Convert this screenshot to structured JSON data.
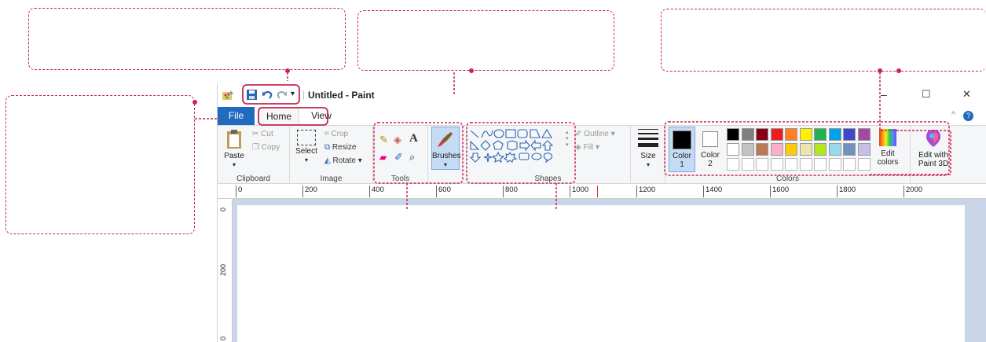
{
  "window": {
    "title": "Untitled - Paint",
    "controls": {
      "minimize": "–",
      "maximize": "☐",
      "close": "✕"
    }
  },
  "tabs": {
    "file": "File",
    "home": "Home",
    "view": "View"
  },
  "clipboard": {
    "paste": "Paste",
    "cut": "Cut",
    "copy": "Copy",
    "label": "Clipboard"
  },
  "image": {
    "select": "Select",
    "crop": "Crop",
    "resize": "Resize",
    "rotate": "Rotate",
    "label": "Image"
  },
  "tools": {
    "label": "Tools"
  },
  "brushes": {
    "label": "Brushes"
  },
  "shapes": {
    "outline": "Outline",
    "fill": "Fill",
    "label": "Shapes"
  },
  "size": {
    "label": "Size"
  },
  "colors": {
    "color1": "Color",
    "color1_num": "1",
    "color2": "Color",
    "color2_num": "2",
    "edit": "Edit",
    "edit2": "colors",
    "label": "Colors",
    "palette_row1": [
      "#000000",
      "#7f7f7f",
      "#880015",
      "#ed1c24",
      "#ff7f27",
      "#fff200",
      "#22b14c",
      "#00a2e8",
      "#3f48cc",
      "#a349a4"
    ],
    "palette_row2": [
      "#ffffff",
      "#c3c3c3",
      "#b97a57",
      "#ffaec9",
      "#ffc90e",
      "#efe4b0",
      "#b5e61d",
      "#99d9ea",
      "#7092be",
      "#c8bfe7"
    ]
  },
  "paint3d": {
    "line1": "Edit with",
    "line2": "Paint 3D"
  },
  "ruler": {
    "h_ticks": [
      "0",
      "200",
      "400",
      "600",
      "800",
      "1000",
      "1200",
      "1400",
      "1600",
      "1800",
      "2000"
    ],
    "v_ticks": [
      "0",
      "200",
      "0"
    ]
  },
  "accent": "#c8264e"
}
